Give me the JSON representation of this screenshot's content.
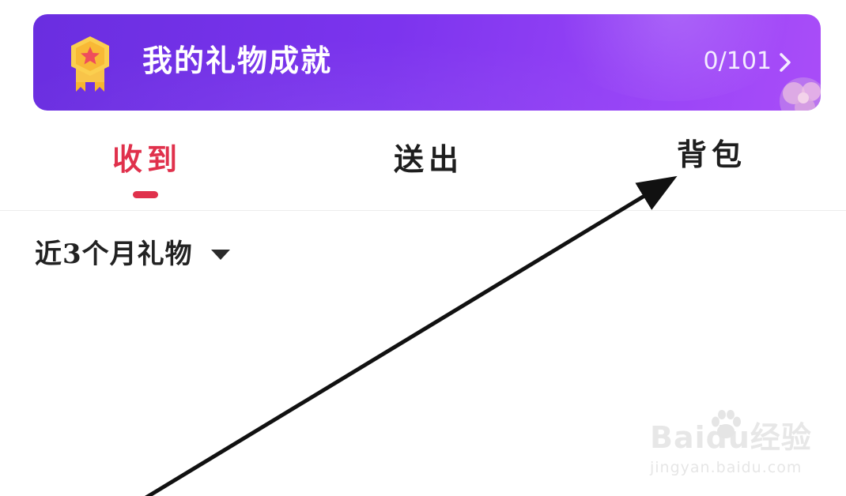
{
  "banner": {
    "title": "我的礼物成就",
    "progress": "0/101",
    "colors": {
      "start": "#6a2ee0",
      "end": "#a94df8"
    },
    "badge_icon": "medal-star-icon",
    "chevron_icon": "chevron-right-icon"
  },
  "tabs": [
    {
      "label": "收到",
      "active": true
    },
    {
      "label": "送出",
      "active": false
    },
    {
      "label": "背包",
      "active": false
    }
  ],
  "accent_color": "#e0314c",
  "filter": {
    "label": "近3个月礼物",
    "icon": "caret-down-icon"
  },
  "watermark": {
    "logo": "Baidu经验",
    "url": "jingyan.baidu.com"
  }
}
